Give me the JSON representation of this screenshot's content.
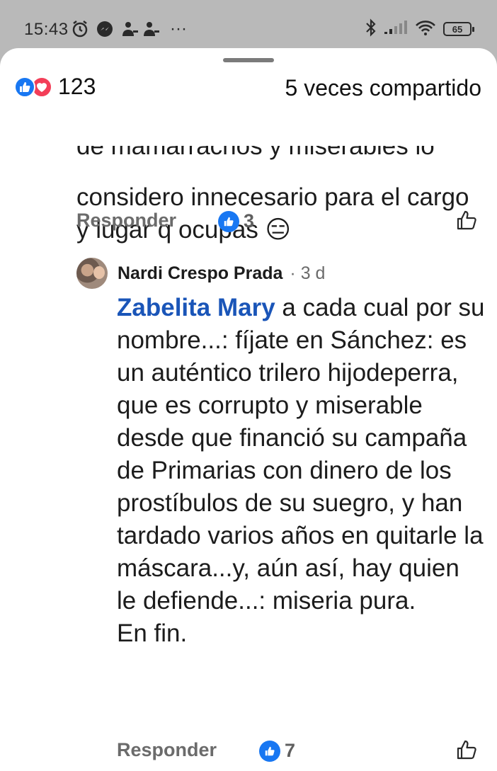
{
  "status_bar": {
    "time": "15:43",
    "battery": "65",
    "icons": [
      "alarm-icon",
      "messenger-icon",
      "person-icon",
      "person-icon",
      "more-dots-icon",
      "bluetooth-icon",
      "signal-icon",
      "wifi-icon",
      "battery-icon"
    ]
  },
  "post_stats": {
    "reaction_count": "123",
    "shares": "5 veces compartido",
    "reactions": [
      "like",
      "love"
    ]
  },
  "comments": [
    {
      "clipped_line": "de mamarrachos  y miserables lo",
      "text": "considero innecesario para el cargo y lugar  q ocupas 😑",
      "reply_label": "Responder",
      "like_count": "3"
    },
    {
      "author": "Nardi Crespo Prada",
      "time": "· 3 d",
      "mention": "Zabelita Mary",
      "text": " a cada cual por su nombre...: fíjate en Sánchez: es un auténtico trilero hijodeperra, que es corrupto y miserable desde que financió su campaña de Primarias con dinero de los prostíbulos de su suegro, y han tardado varios años en quitarle la máscara...y, aún así, hay quien le defiende...: miseria pura.",
      "closing": "En fin.",
      "reply_label": "Responder",
      "like_count": "7"
    }
  ],
  "colors": {
    "facebook_blue": "#1877f2",
    "love_red": "#f33e58",
    "mention_blue": "#1a55b8"
  }
}
